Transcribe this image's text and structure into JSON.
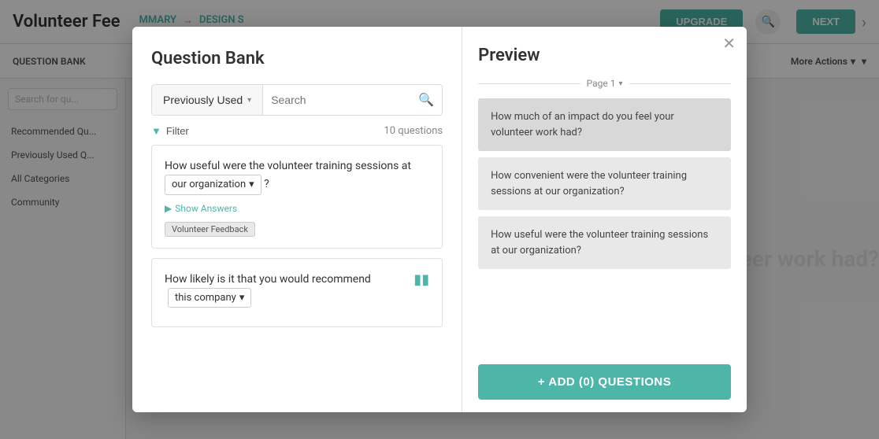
{
  "background": {
    "title": "Volunteer Fee",
    "nav": {
      "summary": "MMARY",
      "design": "DESIGN S"
    },
    "upgrade_label": "UPGRADE",
    "next_label": "NEXT",
    "toolbar": {
      "question_bank": "QUESTION BANK",
      "more_actions": "More Actions"
    },
    "sidebar": {
      "search_placeholder": "Search for qu...",
      "items": [
        "Recommended Qu...",
        "Previously Used Q...",
        "All Categories",
        "Community"
      ]
    },
    "content": {
      "volunteer_text": "leer work had?"
    }
  },
  "modal": {
    "close_label": "✕",
    "left": {
      "title": "Question Bank",
      "dropdown_label": "Previously Used",
      "search_placeholder": "Search",
      "filter_label": "Filter",
      "questions_count": "10 questions",
      "questions": [
        {
          "id": "q1",
          "text_before": "How useful were the volunteer training sessions at",
          "inline_text": "our organization",
          "text_after": "?",
          "show_answers": "Show Answers",
          "tag": "Volunteer Feedback"
        },
        {
          "id": "q2",
          "text_before": "How likely is it that you would recommend",
          "inline_text": "this company",
          "text_after": "",
          "has_bookmark": true
        }
      ]
    },
    "right": {
      "title": "Preview",
      "page_label": "Page 1",
      "preview_items": [
        {
          "id": "p1",
          "text": "How much of an impact do you feel your volunteer work had?",
          "highlighted": true
        },
        {
          "id": "p2",
          "text": "How convenient were the volunteer training sessions at our organization?",
          "highlighted": false
        },
        {
          "id": "p3",
          "text": "How useful were the volunteer training sessions at our organization?",
          "highlighted": false
        }
      ],
      "add_button": "+ ADD (0) QUESTIONS"
    }
  }
}
